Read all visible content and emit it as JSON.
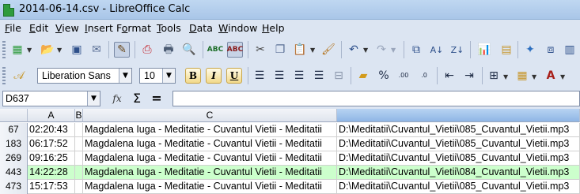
{
  "window": {
    "title": "2014-06-14.csv - LibreOffice Calc"
  },
  "menu": {
    "items": [
      {
        "label": "File",
        "accel": "F"
      },
      {
        "label": "Edit",
        "accel": "E"
      },
      {
        "label": "View",
        "accel": "V"
      },
      {
        "label": "Insert",
        "accel": "I"
      },
      {
        "label": "Format",
        "accel": "o"
      },
      {
        "label": "Tools",
        "accel": "T"
      },
      {
        "label": "Data",
        "accel": "D"
      },
      {
        "label": "Window",
        "accel": "W"
      },
      {
        "label": "Help",
        "accel": "H"
      }
    ]
  },
  "formatting": {
    "font_name": "Liberation Sans",
    "font_size": "10",
    "bold_label": "B",
    "italic_label": "I",
    "underline_label": "U"
  },
  "formula_bar": {
    "name_box": "D637",
    "sum_symbol": "Σ",
    "equals_symbol": "=",
    "content": ""
  },
  "grid": {
    "columns": [
      {
        "label": ""
      },
      {
        "label": "A"
      },
      {
        "label": "B"
      },
      {
        "label": "C"
      },
      {
        "label": ""
      }
    ],
    "rows": [
      {
        "num": "67",
        "a": "02:20:43",
        "b": "",
        "c": "Magdalena Iuga - Meditatie - Cuvantul Vietii - Meditatii",
        "d": "D:\\Meditatii\\Cuvantul_Vietii\\085_Cuvantul_Vietii.mp3",
        "highlight": false
      },
      {
        "num": "183",
        "a": "06:17:52",
        "b": "",
        "c": "Magdalena Iuga - Meditatie - Cuvantul Vietii - Meditatii",
        "d": "D:\\Meditatii\\Cuvantul_Vietii\\085_Cuvantul_Vietii.mp3",
        "highlight": false
      },
      {
        "num": "269",
        "a": "09:16:25",
        "b": "",
        "c": "Magdalena Iuga - Meditatie - Cuvantul Vietii - Meditatii",
        "d": "D:\\Meditatii\\Cuvantul_Vietii\\085_Cuvantul_Vietii.mp3",
        "highlight": false
      },
      {
        "num": "443",
        "a": "14:22:28",
        "b": "",
        "c": "Magdalena Iuga - Meditatie - Cuvantul Vietii - Meditatii",
        "d": "D:\\Meditatii\\Cuvantul_Vietii\\084_Cuvantul_Vietii.mp3",
        "highlight": true
      },
      {
        "num": "473",
        "a": "15:17:53",
        "b": "",
        "c": "Magdalena Iuga - Meditatie - Cuvantul Vietii - Meditatii",
        "d": "D:\\Meditatii\\Cuvantul_Vietii\\085_Cuvantul_Vietii.mp3",
        "highlight": false
      }
    ]
  },
  "colors": {
    "highlight_row": "#ccffcc",
    "selected_column": "#8fb6e5",
    "app_icon": "#2e9b3d"
  }
}
